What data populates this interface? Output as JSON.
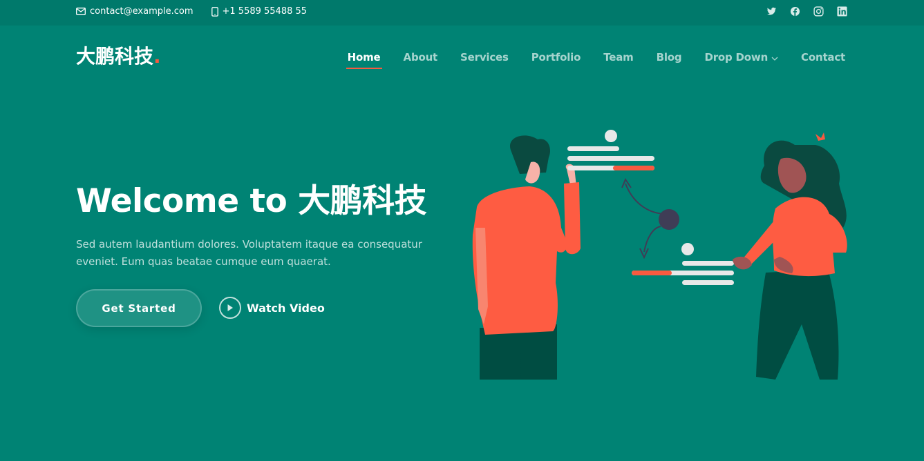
{
  "topbar": {
    "email": "contact@example.com",
    "phone": "+1 5589 55488 55",
    "social": [
      "twitter-icon",
      "facebook-icon",
      "instagram-icon",
      "linkedin-icon"
    ]
  },
  "header": {
    "logo_text": "大鹏科技",
    "logo_dot": ".",
    "nav": [
      {
        "label": "Home",
        "active": true
      },
      {
        "label": "About"
      },
      {
        "label": "Services"
      },
      {
        "label": "Portfolio"
      },
      {
        "label": "Team"
      },
      {
        "label": "Blog"
      },
      {
        "label": "Drop Down",
        "has_dropdown": true
      },
      {
        "label": "Contact"
      }
    ]
  },
  "hero": {
    "title": "Welcome to 大鹏科技",
    "description": "Sed autem laudantium dolores. Voluptatem itaque ea consequatur eveniet. Eum quas beatae cumque eum quaerat.",
    "primary_button": "Get Started",
    "video_button": "Watch Video"
  },
  "colors": {
    "background": "#008374",
    "topbar": "#00796b",
    "accent": "#f85a40",
    "shirt": "#fe5c42",
    "pants": "#004d42",
    "hair": "#0a4a40"
  }
}
